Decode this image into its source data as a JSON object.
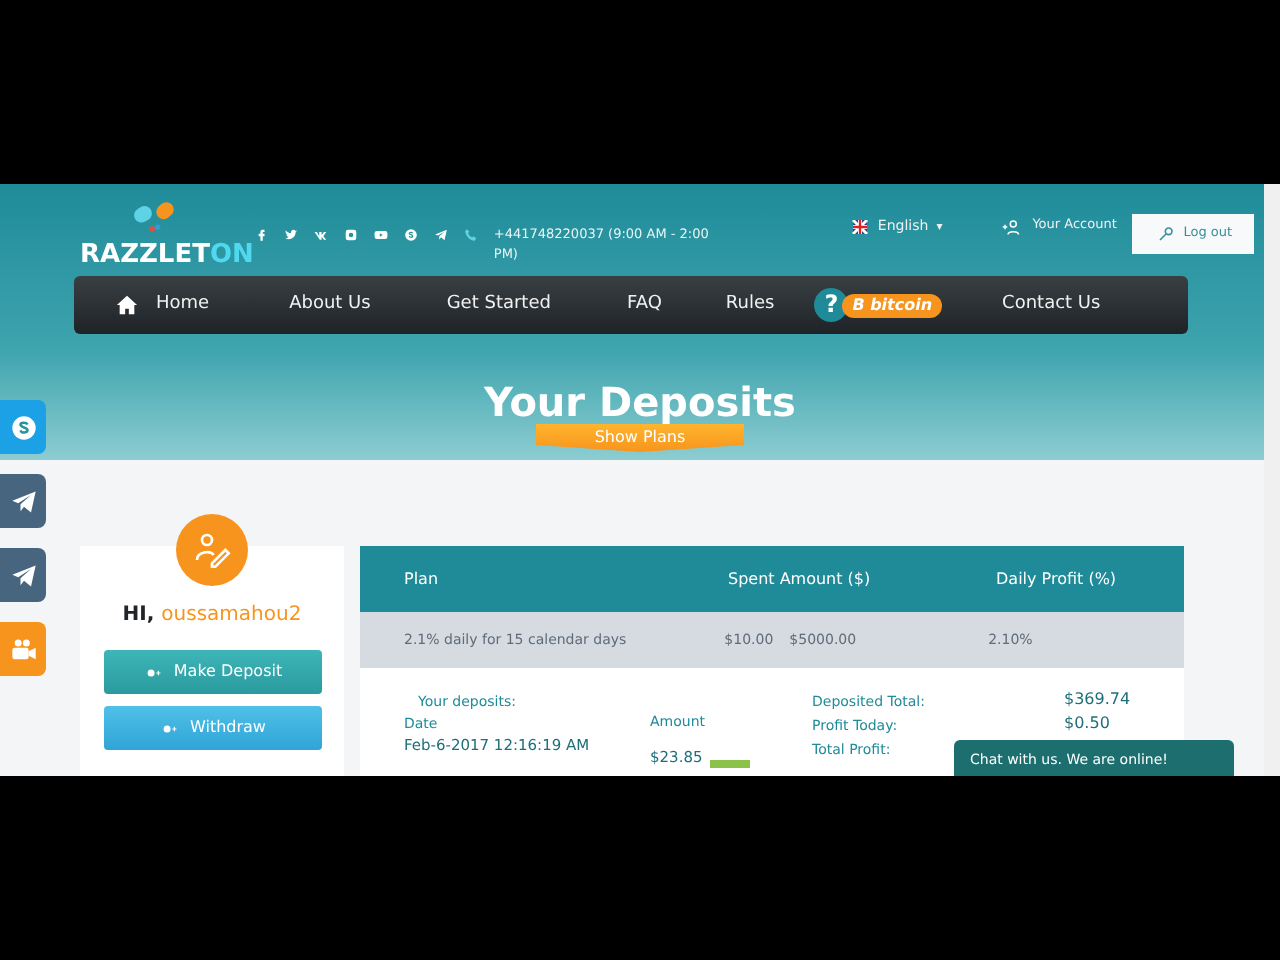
{
  "header": {
    "logo": {
      "part_1": "RAZZLET",
      "part_2": "ON"
    },
    "social": [
      {
        "kind": "facebook"
      },
      {
        "kind": "twitter"
      },
      {
        "kind": "vk"
      },
      {
        "kind": "instagram"
      },
      {
        "kind": "youtube"
      },
      {
        "kind": "skype"
      },
      {
        "kind": "telegram"
      }
    ],
    "phone": "+441748220037 (9:00 AM - 2:00 PM)",
    "language": "English",
    "language_caret": "▾",
    "account": "Your Account",
    "logout": "Log out"
  },
  "nav": [
    {
      "kind": "home",
      "label": "Home"
    },
    {
      "kind": "link",
      "label": "About Us"
    },
    {
      "kind": "link",
      "label": "Get Started"
    },
    {
      "kind": "link",
      "label": "FAQ"
    },
    {
      "kind": "link",
      "label": "Rules"
    },
    {
      "kind": "help",
      "label": "?",
      "badge": "B bitcoin"
    },
    {
      "kind": "link",
      "label": "Contact Us"
    }
  ],
  "title": "Your Deposits",
  "show_plans": "Show Plans",
  "side_icons": [
    {
      "kind": "skype"
    },
    {
      "kind": "chat"
    },
    {
      "kind": "telegram"
    },
    {
      "kind": "video"
    }
  ],
  "user": {
    "greeting": "HI,",
    "name": "oussamahou2",
    "buttons": [
      "Make Deposit",
      "Withdraw"
    ]
  },
  "table": {
    "columns": [
      "Plan",
      "Spent Amount ($)",
      "Daily Profit (%)"
    ],
    "row": {
      "plan": "2.1% daily for 15 calendar days",
      "min": "$10.00",
      "max": "$5000.00",
      "profit": "2.10%"
    },
    "deposits_label": "Your deposits:",
    "date_label": "Date",
    "date": "Feb-6-2017 12:16:19 AM",
    "amount_label": "Amount",
    "amount": "$23.85",
    "totals": [
      {
        "label": "Deposited Total:",
        "value": "$369.74"
      },
      {
        "label": "Profit Today:",
        "value": "$0.50"
      },
      {
        "label": "Total Profit:"
      }
    ]
  },
  "chat": "Chat with us. We are online!"
}
